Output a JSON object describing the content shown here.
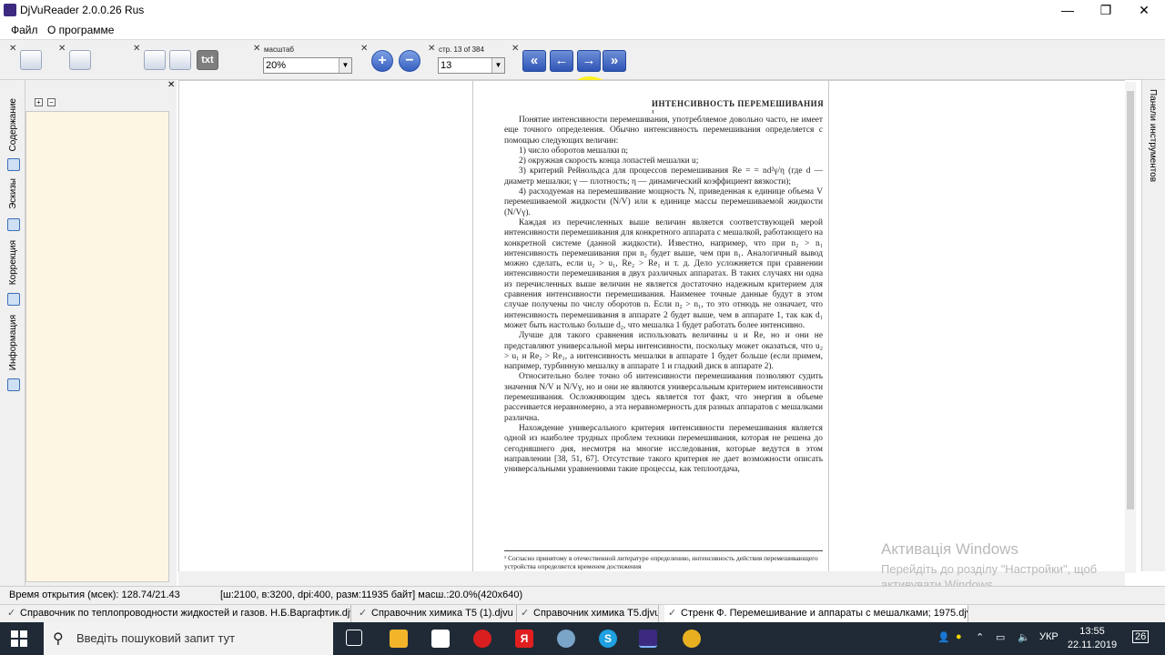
{
  "window": {
    "title": "DjVuReader 2.0.0.26 Rus",
    "minimize": "—",
    "maximize": "❐",
    "close": "✕"
  },
  "menu": {
    "file": "Файл",
    "about": "О программе"
  },
  "toolbar": {
    "close_glyph": "✕",
    "txt_label": "txt",
    "scale_label": "масштаб",
    "scale_value": "20%",
    "page_label": "стр. 13 of 384",
    "page_value": "13",
    "zoom_in": "+",
    "zoom_out": "−",
    "first": "«",
    "prev": "←",
    "next": "→",
    "last": "»"
  },
  "sidebar": {
    "tabs": [
      "Содержание",
      "Эскизы",
      "Коррекция",
      "Информация"
    ],
    "expand": "+",
    "collapse": "−",
    "close_glyph": "✕"
  },
  "right_panel": {
    "label": "Панели инструментов"
  },
  "page": {
    "heading": "ИНТЕНСИВНОСТЬ  ПЕРЕМЕШИВАНИЯ ¹",
    "paragraphs": [
      "Понятие интенсивности перемешивания, употребляемое довольно часто, не имеет еще точного определения. Обычно интенсивность перемешивания определяется с помощью следующих величин:",
      "1) число оборотов мешалки n;",
      "2) окружная скорость конца лопастей мешалки u;",
      "3) критерий Рейнольдса для процессов перемешивания Re = = nd²γ/η (где d — диаметр мешалки; γ — плотность; η — динамический коэффициент вязкости);",
      "4) расходуемая на перемешивание мощность N, приведенная к единице объема V перемешиваемой жидкости (N/V) или к единице массы перемешиваемой жидкости (N/Vγ).",
      "Каждая из перечисленных выше величин является соответствующей мерой интенсивности перемешивания для конкретного аппарата с мешалкой, работающего на конкретной системе (данной жидкости). Известно, например, что при n₂ > n₁ интенсивность перемешивания при n₂ будет выше, чем при n₁. Аналогичный вывод можно сделать, если u₂ > u₁, Re₂ > Re₁ и т. д. Дело усложняется при сравнении интенсивности перемешивания в двух различных аппаратах. В таких случаях ни одна из перечисленных выше величин не является достаточно надежным критерием для сравнения интенсивности перемешивания. Наименее точные данные будут в этом случае получены по числу оборотов n. Если n₂ > n₁, то это отнюдь не означает, что интенсивность перемешивания в аппарате 2 будет выше, чем в аппарате 1, так как d₁ может быть настолько больше d₂, что мешалка 1 будет работать более интенсивно.",
      "Лучше для такого сравнения использовать величины u и Re, но и они не представляют универсальной меры интенсивности, поскольку может оказаться, что u₂ > u₁ и Re₂ > Re₁, а интенсивность мешалки в аппарате 1 будет больше (если примем, например, турбинную мешалку в аппарате 1 и гладкий диск в аппарате 2).",
      "Относительно более точно об интенсивности перемешивания позволяют судить значения N/V и N/Vγ, но и они не являются универсальным критерием интенсивности перемешивания. Осложняющим здесь является тот факт, что энергия в объеме рассеивается неравномерно, а эта неравномерность для разных аппаратов с мешалками различна.",
      "Нахождение универсального критерия интенсивности перемешивания является одной из наиболее трудных проблем техники перемешивания, которая не решена до сегодняшнего дня, несмотря на многие исследования, которые ведутся в этом направлении [38, 51, 67]. Отсутствие такого критерия не дает возможности описать универсальными уравнениями такие процессы, как теплоотдача,"
    ],
    "footnote": "¹ Согласно принятому в отечественной литературе определению, интенсивность действия перемешивающего устройства определяется временем достижения"
  },
  "watermark": {
    "line1": "Активація Windows",
    "line2": "Перейдіть до розділу \"Настройки\", щоб",
    "line3": "активувати Windows."
  },
  "status": {
    "open_time": "Время открытия (мсек): 128.74/21.43",
    "info": "[ш:2100, в:3200, dpi:400, разм:11935 байт] масш.:20.0%(420x640)"
  },
  "doc_tabs": [
    "Справочник по теплопроводности жидкостей и газов. Н.Б.Варгафтик.djvu",
    "Справочник химика Т5 (1).djvu",
    "Справочник химика Т5.djvu",
    "Стренк Ф. Перемешивание и аппараты с мешалками; 1975.djvu"
  ],
  "doc_tabs_check": "✓",
  "taskbar": {
    "search_placeholder": "Введіть пошуковий запит тут",
    "lang": "УКР",
    "time": "13:55",
    "date": "22.11.2019",
    "notifications": "26",
    "icon_labels": {
      "skype": "S",
      "yandex": "Я"
    }
  },
  "colors": {
    "highlight": "#ffee00",
    "nav_blue": "#2f55b5",
    "taskbar": "#1f2a36",
    "sidebar_bg": "#fdf6e3"
  }
}
